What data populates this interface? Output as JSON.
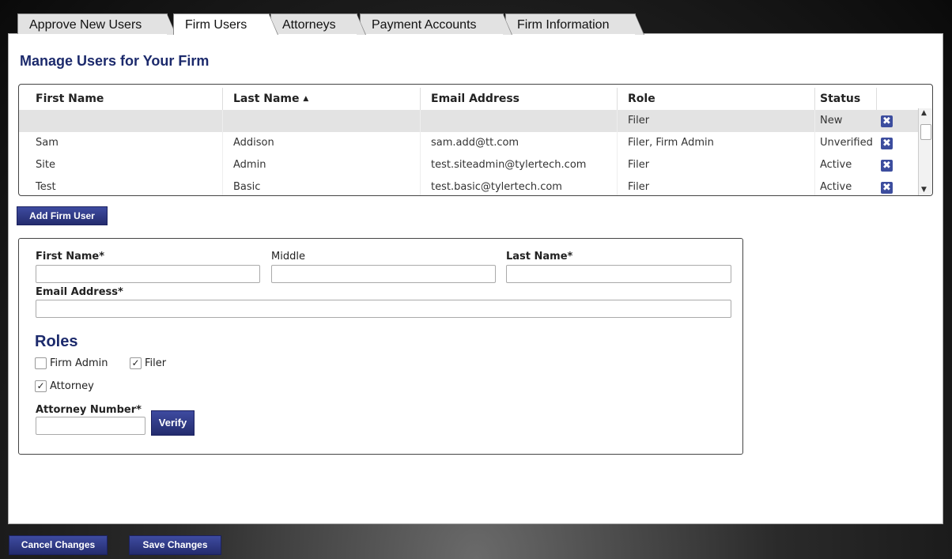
{
  "tabs": [
    {
      "label": "Approve New Users",
      "active": false
    },
    {
      "label": "Firm Users",
      "active": true
    },
    {
      "label": "Attorneys",
      "active": false
    },
    {
      "label": "Payment Accounts",
      "active": false
    },
    {
      "label": "Firm Information",
      "active": false
    }
  ],
  "page_title": "Manage Users for Your Firm",
  "grid": {
    "headers": {
      "first_name": "First Name",
      "last_name": "Last Name",
      "sort_indicator": "▲",
      "email": "Email Address",
      "role": "Role",
      "status": "Status"
    },
    "rows": [
      {
        "first": "",
        "last": "",
        "email": "",
        "role": "Filer",
        "status": "New",
        "selected": true
      },
      {
        "first": "Sam",
        "last": "Addison",
        "email": "sam.add@tt.com",
        "role": "Filer, Firm Admin",
        "status": "Unverified"
      },
      {
        "first": "Site",
        "last": "Admin",
        "email": "test.siteadmin@tylertech.com",
        "role": "Filer",
        "status": "Active"
      },
      {
        "first": "Test",
        "last": "Basic",
        "email": "test.basic@tylertech.com",
        "role": "Filer",
        "status": "Active"
      }
    ],
    "delete_icon": "delete-x-icon"
  },
  "add_user_button": "Add Firm User",
  "form": {
    "first_name_label": "First Name*",
    "middle_label": "Middle",
    "last_name_label": "Last Name*",
    "email_label": "Email Address*",
    "first_name_value": "",
    "middle_value": "",
    "last_name_value": "",
    "email_value": "",
    "roles_title": "Roles",
    "roles": {
      "firm_admin": {
        "label": "Firm Admin",
        "checked": false
      },
      "filer": {
        "label": "Filer",
        "checked": true
      },
      "attorney": {
        "label": "Attorney",
        "checked": true
      }
    },
    "attorney_number_label": "Attorney Number*",
    "attorney_number_value": "",
    "verify_button": "Verify"
  },
  "footer": {
    "cancel_button": "Cancel Changes",
    "save_button": "Save Changes"
  },
  "colors": {
    "accent": "#1c2a6c",
    "button": "#2f3a85"
  }
}
